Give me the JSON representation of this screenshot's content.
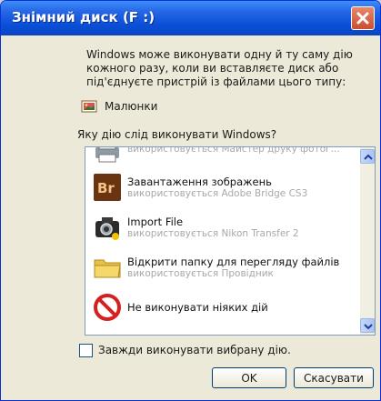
{
  "window": {
    "title": "Знімний диск (F :)"
  },
  "intro_text": "Windows може виконувати одну й ту саму дію кожного разу, коли ви вставляєте диск або під'єднуєте пристрій із файлами цього типу:",
  "content_type": {
    "label": "Малюнки",
    "icon": "pictures-icon"
  },
  "question": "Яку дію слід виконувати Windows?",
  "actions": [
    {
      "title": "",
      "subtitle": "використовується Майстер друку фотог...",
      "icon": "print-wizard-icon"
    },
    {
      "title": "Завантаження зображень",
      "subtitle": "використовується Adobe Bridge CS3",
      "icon": "adobe-bridge-icon"
    },
    {
      "title": "Import File",
      "subtitle": "використовується Nikon Transfer 2",
      "icon": "nikon-transfer-icon"
    },
    {
      "title": "Відкрити папку для перегляду файлів",
      "subtitle": "використовується Провідник",
      "icon": "folder-icon"
    },
    {
      "title": "Не виконувати ніяких дій",
      "subtitle": "",
      "icon": "no-action-icon"
    }
  ],
  "always_checkbox": {
    "label": "Завжди виконувати вибрану дію.",
    "checked": false
  },
  "buttons": {
    "ok": "OK",
    "cancel": "Скасувати"
  },
  "colors": {
    "titlebar": "#0a4fd8",
    "close": "#c94e2e",
    "window_bg": "#ece9d8"
  }
}
